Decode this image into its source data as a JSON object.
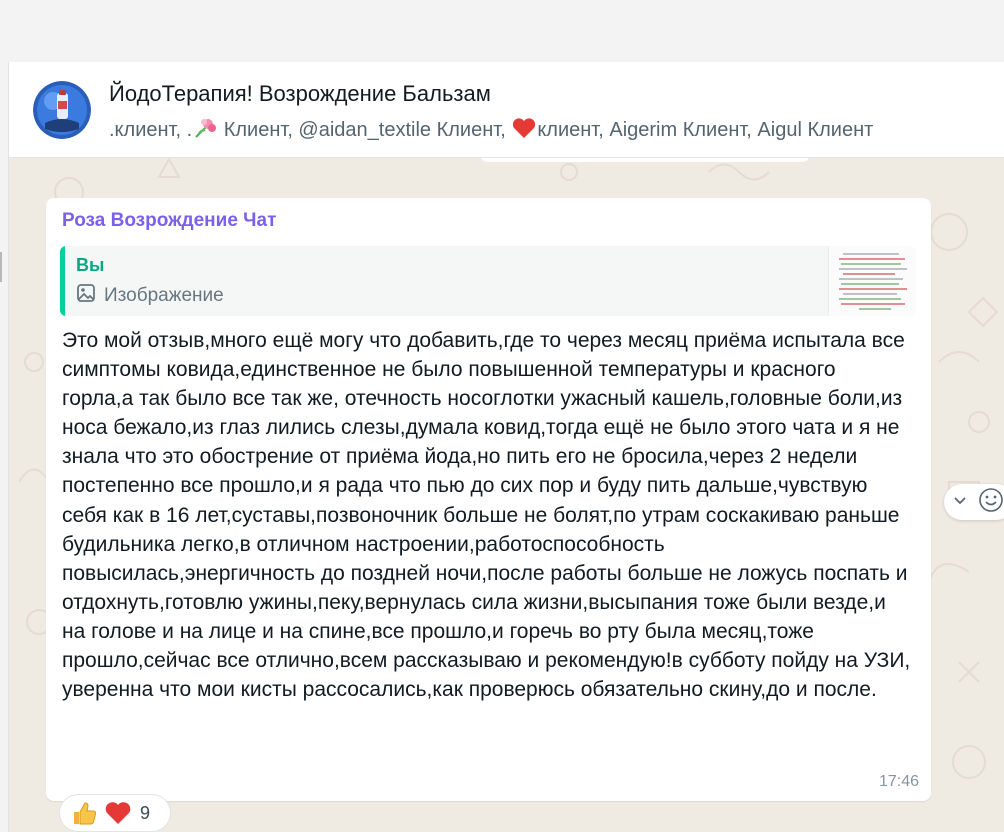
{
  "header": {
    "title": "ЙодоТерапия! Возрождение Бальзам",
    "members_part1": ".клиент, .",
    "members_part2": " Клиент, @aidan_textile Клиент, ",
    "members_part3": "клиент, Aigerim Клиент, Aigul Клиент",
    "avatar_icon": "group-avatar-icon"
  },
  "message": {
    "sender": "Роза Возрождение Чат",
    "sender_color": "#7b61e8",
    "quote": {
      "author": "Вы",
      "type_label": "Изображение",
      "accent_color": "#06cf9c"
    },
    "text": "Это мой отзыв,много ещё могу что добавить,где то через месяц приёма испытала все симптомы ковида,единственное не было повышенной температуры и красного горла,а так было все так же, отечность носоглотки ужасный кашель,головные боли,из носа бежало,из глаз лились слезы,думала ковид,тогда ещё не было этого чата и я не знала что это обострение от приёма йода,но пить его не бросила,через 2 недели постепенно все прошло,и я рада что пью до сих пор и буду пить дальше,чувствую себя как в 16 лет,суставы,позвоночник больше не болят,по утрам соскакиваю раньше будильника легко,в отличном настроении,работоспособность повысилась,энергичность до поздней ночи,после работы больше не ложусь поспать и отдохнуть,готовлю ужины,пеку,вернулась сила жизни,высыпания тоже были везде,и на голове и на лице и на спине,все прошло,и горечь во рту была месяц,тоже прошло,сейчас все отлично,всем рассказываю и рекомендую!в субботу пойду на УЗИ, уверенна что мои кисты рассосались,как проверюсь обязательно скину,до и после.",
    "time": "17:46",
    "reactions": {
      "icons": [
        "thumbs-up-icon",
        "heart-icon"
      ],
      "count": "9"
    }
  },
  "colors": {
    "chat_background": "#efeae2",
    "bubble": "#ffffff",
    "text": "#111b21",
    "meta": "#8696a0"
  }
}
